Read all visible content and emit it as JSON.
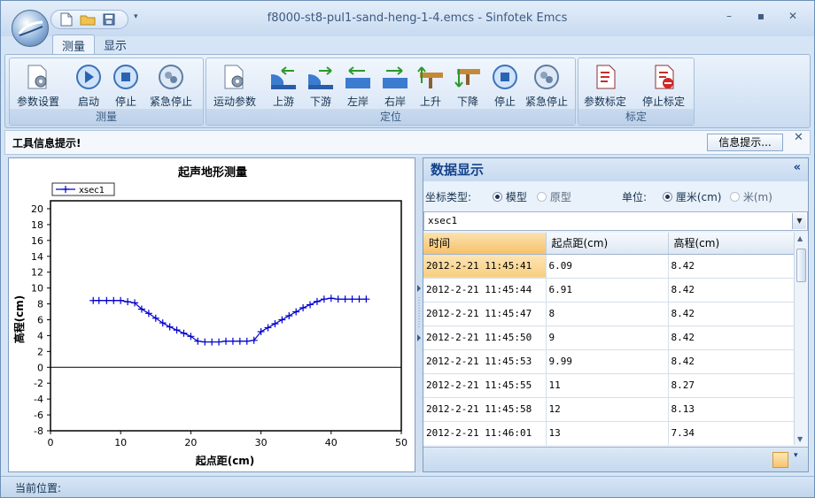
{
  "window": {
    "title": "f8000-st8-pul1-sand-heng-1-4.emcs - Sinfotek Emcs"
  },
  "quick_access": {
    "icons": [
      "new-file-icon",
      "open-folder-icon",
      "save-icon"
    ]
  },
  "ribbon_tabs": [
    {
      "label": "测量",
      "active": true
    },
    {
      "label": "显示",
      "active": false
    }
  ],
  "ribbon_groups": {
    "measure": {
      "label": "测量",
      "buttons": [
        {
          "label": "参数设置",
          "icon": "gear-doc-icon"
        },
        {
          "label": "启动",
          "icon": "play-icon"
        },
        {
          "label": "停止",
          "icon": "stop-icon"
        },
        {
          "label": "紧急停止",
          "icon": "emergency-stop-icon"
        }
      ]
    },
    "position": {
      "label": "定位",
      "buttons": [
        {
          "label": "运动参数",
          "icon": "motion-params-icon"
        },
        {
          "label": "上游",
          "icon": "upstream-icon"
        },
        {
          "label": "下游",
          "icon": "downstream-icon"
        },
        {
          "label": "左岸",
          "icon": "left-bank-icon"
        },
        {
          "label": "右岸",
          "icon": "right-bank-icon"
        },
        {
          "label": "上升",
          "icon": "rise-icon"
        },
        {
          "label": "下降",
          "icon": "lower-icon"
        },
        {
          "label": "停止",
          "icon": "stop-icon"
        },
        {
          "label": "紧急停止",
          "icon": "emergency-stop-icon"
        }
      ]
    },
    "calibrate": {
      "label": "标定",
      "buttons": [
        {
          "label": "参数标定",
          "icon": "calibrate-doc-icon"
        },
        {
          "label": "停止标定",
          "icon": "stop-calibrate-icon"
        }
      ]
    }
  },
  "info_bar": {
    "label": "工具信息提示!",
    "button": "信息提示..."
  },
  "chart_data": {
    "type": "line",
    "title": "起声地形测量",
    "xlabel": "起点距(cm)",
    "ylabel": "高程(cm)",
    "xlim": [
      0,
      50
    ],
    "ylim": [
      -8,
      21
    ],
    "xticks": [
      0,
      10,
      20,
      30,
      40,
      50
    ],
    "yticks": [
      -8,
      -6,
      -4,
      -2,
      0,
      2,
      4,
      6,
      8,
      10,
      12,
      14,
      16,
      18,
      20
    ],
    "grid": true,
    "legend": "top-left",
    "series": [
      {
        "name": "xsec1",
        "color": "#0000cc",
        "x": [
          6.09,
          6.91,
          8,
          9,
          9.99,
          11,
          12,
          13,
          14,
          15,
          16,
          17,
          18,
          19,
          20,
          21,
          22,
          23,
          24,
          25,
          26,
          27,
          28,
          29,
          30,
          31,
          32,
          33,
          34,
          35,
          36,
          37,
          38,
          39,
          40,
          41,
          42,
          43,
          44,
          45
        ],
        "y": [
          8.42,
          8.42,
          8.42,
          8.42,
          8.42,
          8.27,
          8.13,
          7.34,
          6.8,
          6.2,
          5.6,
          5.1,
          4.7,
          4.3,
          3.9,
          3.3,
          3.2,
          3.2,
          3.2,
          3.3,
          3.3,
          3.3,
          3.3,
          3.4,
          4.5,
          5.0,
          5.5,
          6.0,
          6.5,
          7.0,
          7.5,
          7.9,
          8.3,
          8.6,
          8.7,
          8.6,
          8.6,
          8.6,
          8.6,
          8.6
        ]
      }
    ]
  },
  "data_panel": {
    "title": "数据显示",
    "coord_label": "坐标类型:",
    "coord_options": [
      {
        "label": "模型",
        "checked": true
      },
      {
        "label": "原型",
        "checked": false
      }
    ],
    "unit_label": "单位:",
    "unit_options": [
      {
        "label": "厘米(cm)",
        "checked": true
      },
      {
        "label": "米(m)",
        "checked": false
      }
    ],
    "series_select": "xsec1",
    "columns": [
      "时间",
      "起点距(cm)",
      "高程(cm)"
    ],
    "rows": [
      [
        "2012-2-21 11:45:41",
        "6.09",
        "8.42"
      ],
      [
        "2012-2-21 11:45:44",
        "6.91",
        "8.42"
      ],
      [
        "2012-2-21 11:45:47",
        "8",
        "8.42"
      ],
      [
        "2012-2-21 11:45:50",
        "9",
        "8.42"
      ],
      [
        "2012-2-21 11:45:53",
        "9.99",
        "8.42"
      ],
      [
        "2012-2-21 11:45:55",
        "11",
        "8.27"
      ],
      [
        "2012-2-21 11:45:58",
        "12",
        "8.13"
      ],
      [
        "2012-2-21 11:46:01",
        "13",
        "7.34"
      ]
    ]
  },
  "status_bar": {
    "label": "当前位置:"
  }
}
